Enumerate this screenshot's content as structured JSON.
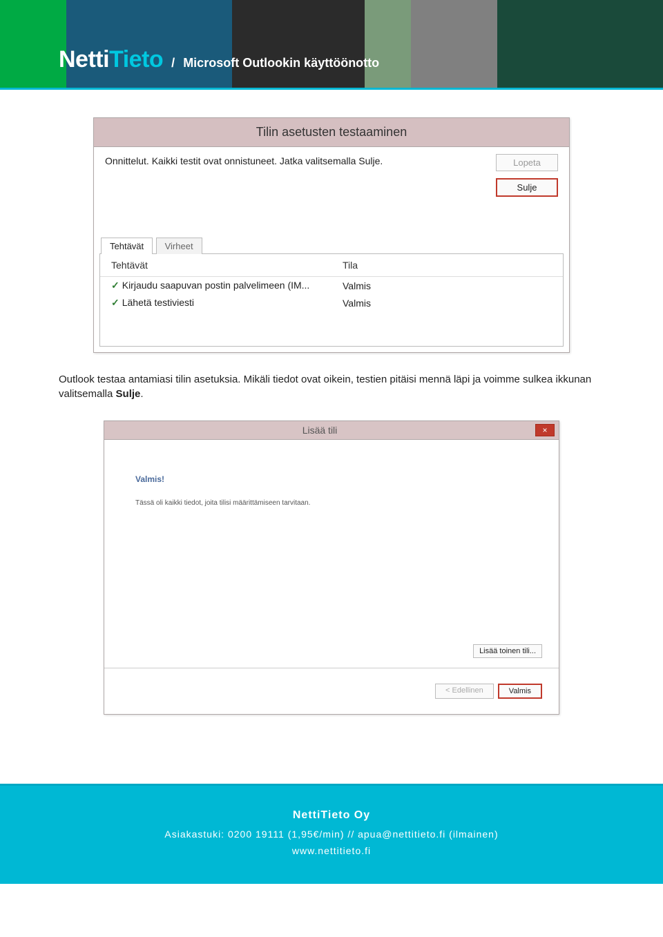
{
  "header": {
    "logo_part1": "Netti",
    "logo_part2": "Tieto",
    "slash": "/",
    "page_title": "Microsoft Outlookin käyttöönotto"
  },
  "dialog1": {
    "title": "Tilin asetusten testaaminen",
    "message": "Onnittelut. Kaikki testit ovat onnistuneet. Jatka valitsemalla Sulje.",
    "btn_stop": "Lopeta",
    "btn_close": "Sulje",
    "tab_tasks": "Tehtävät",
    "tab_errors": "Virheet",
    "col_task": "Tehtävät",
    "col_state": "Tila",
    "rows": [
      {
        "task": "Kirjaudu saapuvan postin palvelimeen (IM...",
        "state": "Valmis"
      },
      {
        "task": "Lähetä testiviesti",
        "state": "Valmis"
      }
    ]
  },
  "body_paragraph": {
    "pre": "Outlook testaa antamiasi tilin asetuksia. Mikäli tiedot ovat oikein, testien pitäisi mennä läpi ja voimme sulkea ikkunan valitsemalla ",
    "bold": "Sulje",
    "post": "."
  },
  "dialog2": {
    "title": "Lisää tili",
    "heading": "Valmis!",
    "subtext": "Tässä oli kaikki tiedot, joita tilisi määrittämiseen tarvitaan.",
    "btn_add_another": "Lisää toinen tili...",
    "btn_back": "< Edellinen",
    "btn_finish": "Valmis"
  },
  "footer": {
    "company": "NettiTieto Oy",
    "support_line": "Asiakastuki: 0200 19111 (1,95€/min)   //   apua@nettitieto.fi (ilmainen)",
    "url": "www.nettitieto.fi"
  }
}
